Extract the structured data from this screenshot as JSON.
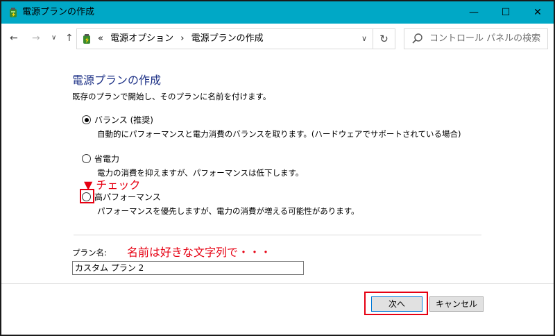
{
  "window": {
    "title": "電源プランの作成",
    "minimize": "—",
    "maximize": "☐",
    "close": "✕",
    "accent": "#00a8c6"
  },
  "nav": {
    "back": "←",
    "forward": "→",
    "recent": "∨",
    "up": "↑"
  },
  "address": {
    "prefix": "«",
    "crumbs": [
      "電源オプション",
      "›",
      "電源プランの作成"
    ],
    "dropdown": "∨",
    "refresh": "↻"
  },
  "search": {
    "placeholder": "コントロール パネルの検索"
  },
  "page": {
    "heading": "電源プランの作成",
    "intro": "既存のプランで開始し、そのプランに名前を付けます。",
    "options": [
      {
        "label": "バランス (推奨)",
        "desc": "自動的にパフォーマンスと電力消費のバランスを取ります。(ハードウェアでサポートされている場合)",
        "selected": true
      },
      {
        "label": "省電力",
        "desc": "電力の消費を抑えますが、パフォーマンスは低下します。",
        "selected": false
      },
      {
        "label": "高パフォーマンス",
        "desc": "パフォーマンスを優先しますが、電力の消費が増える可能性があります。",
        "selected": false
      }
    ],
    "plan_name_label": "プラン名:",
    "plan_name_value": "カスタム プラン 2"
  },
  "buttons": {
    "next": "次へ",
    "cancel": "キャンセル"
  },
  "annotations": {
    "check": "▼ チェック",
    "name_hint": "名前は好きな文字列で・・・",
    "color": "#e60012"
  }
}
